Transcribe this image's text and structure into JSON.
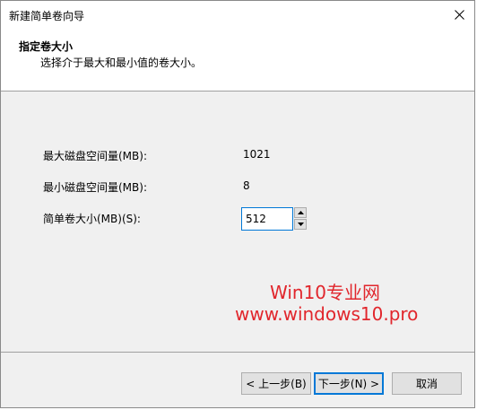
{
  "window": {
    "title": "新建简单卷向导"
  },
  "header": {
    "title": "指定卷大小",
    "subtitle": "选择介于最大和最小值的卷大小。"
  },
  "fields": {
    "max_label": "最大磁盘空间量(MB):",
    "max_value": "1021",
    "min_label": "最小磁盘空间量(MB):",
    "min_value": "8",
    "size_label": "简单卷大小(MB)(S):",
    "size_value": "512"
  },
  "watermark": {
    "line1": "Win10专业网",
    "line2": "www.windows10.pro"
  },
  "buttons": {
    "back": "< 上一步(B)",
    "next": "下一步(N) >",
    "cancel": "取消"
  },
  "colors": {
    "accent": "#0078d7",
    "watermark": "#e1262c"
  },
  "icons": {
    "close": "close-icon",
    "spin_up": "triangle-up-icon",
    "spin_down": "triangle-down-icon"
  }
}
